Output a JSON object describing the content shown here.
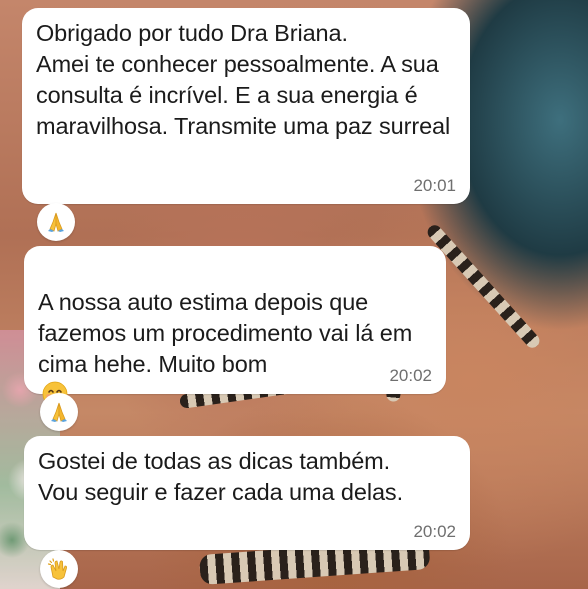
{
  "messages": [
    {
      "text": "Obrigado por tudo Dra Briana.\nAmei te conhecer pessoalmente. A sua consulta é incrível. E a sua energia é maravilhosa. Transmite uma paz surreal",
      "time": "20:01",
      "reaction": "praying-hands-icon"
    },
    {
      "text": "A nossa auto estima depois que fazemos um procedimento vai lá em cima hehe. Muito bom",
      "emoji": "smiling-face-icon",
      "time": "20:02",
      "reaction": "praying-hands-icon"
    },
    {
      "text": "Gostei de todas as dicas também.\nVou seguir e fazer cada uma delas.",
      "time": "20:02",
      "reaction": "clapping-hands-icon"
    }
  ],
  "colors": {
    "bubble": "#ffffff",
    "text": "#1b1b1b",
    "timestamp": "#6f6f6f",
    "emoji_yellow": "#f7c23a"
  }
}
